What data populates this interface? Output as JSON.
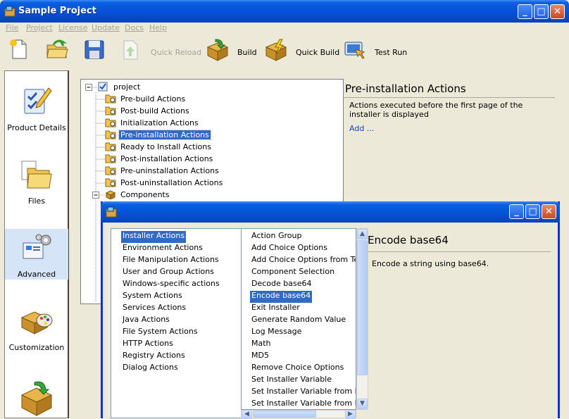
{
  "window": {
    "title": "Sample Project"
  },
  "menu": [
    "File",
    "Project",
    "License",
    "Update",
    "Docs",
    "Help"
  ],
  "toolbar": {
    "quick_reload": "Quick Reload",
    "build": "Build",
    "quick_build": "Quick Build",
    "test_run": "Test Run"
  },
  "nav": {
    "product_details": "Product Details",
    "files": "Files",
    "advanced": "Advanced",
    "customization": "Customization"
  },
  "tree": {
    "root": "project",
    "items": [
      "Pre-build Actions",
      "Post-build Actions",
      "Initialization Actions",
      "Pre-installation Actions",
      "Ready to Install Actions",
      "Post-installation Actions",
      "Pre-uninstallation Actions",
      "Post-uninstallation Actions",
      "Components"
    ]
  },
  "detail": {
    "title": "Pre-installation Actions",
    "description": "Actions executed before the first page of the installer is displayed",
    "add_link": "Add ..."
  },
  "dialog": {
    "categories": [
      "Installer Actions",
      "Environment Actions",
      "File Manipulation Actions",
      "User and Group Actions",
      "Windows-specific actions",
      "System Actions",
      "Services Actions",
      "Java Actions",
      "File System Actions",
      "HTTP Actions",
      "Registry Actions",
      "Dialog Actions"
    ],
    "actions": [
      "Action Group",
      "Add Choice Options",
      "Add Choice Options from Text",
      "Component Selection",
      "Decode base64",
      "Encode base64",
      "Exit Installer",
      "Generate Random Value",
      "Log Message",
      "Math",
      "MD5",
      "Remove Choice Options",
      "Set Installer Variable",
      "Set Installer Variable from Regu",
      "Set Installer Variable from Progr"
    ],
    "detail_title": "Encode base64",
    "detail_desc": "Encode a string using base64."
  },
  "colors": {
    "selection": "#316ac5",
    "titlebar": "#0553d8",
    "link": "#1a3fbd"
  }
}
